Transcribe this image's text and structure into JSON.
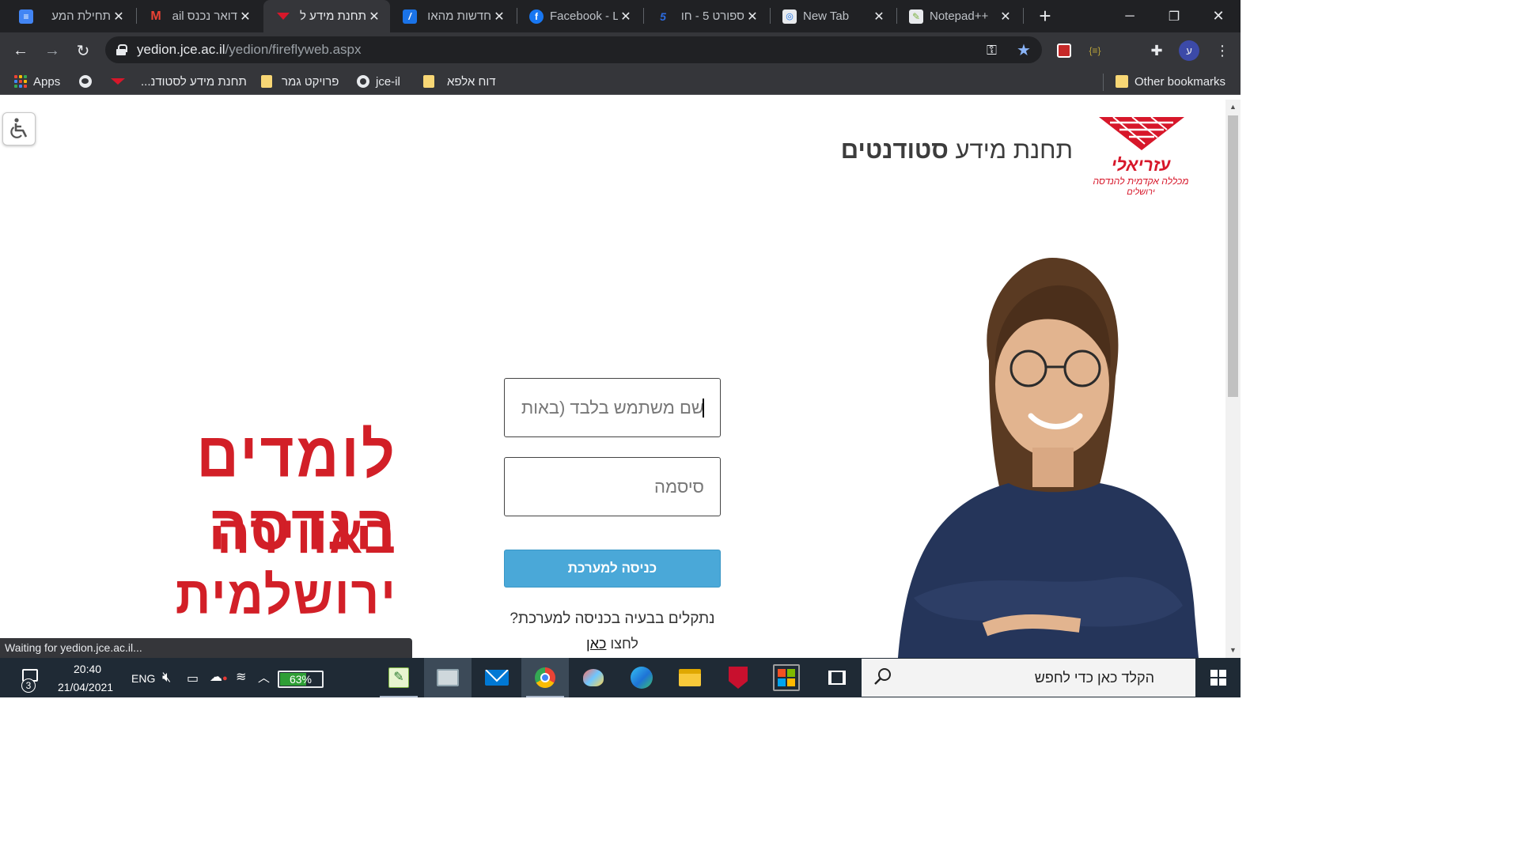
{
  "tabs": [
    {
      "title": "תחילת המע",
      "icon": "google-docs-icon",
      "color": "#4285f4"
    },
    {
      "title": "דואר נכנס ail",
      "icon": "gmail-icon",
      "color": "#ea4335"
    },
    {
      "title": "תחנת מידע ל",
      "icon": "azrieli-icon",
      "color": "#d7172a"
    },
    {
      "title": "חדשות מהאו",
      "icon": "news-icon",
      "color": "#1a73e8"
    },
    {
      "title": "Facebook - L",
      "icon": "facebook-icon",
      "color": "#1877f2"
    },
    {
      "title": "ספורט 5 - חו",
      "icon": "sport5-icon",
      "color": "#2c6be0"
    },
    {
      "title": "New Tab",
      "icon": "new-tab-icon",
      "color": "#9aa0a6"
    },
    {
      "title": "Notepad++ ",
      "icon": "notepadpp-icon",
      "color": "#7cb342"
    }
  ],
  "address_bar": {
    "host": "yedion.jce.ac.il",
    "path": "/yedion/fireflyweb.aspx"
  },
  "profile_initial": "ע",
  "bookmarks": {
    "apps": "Apps",
    "items": [
      "תחנת מידע לסטודנ...",
      "פרויקט גמר",
      "jce-il",
      "דוח אלפא"
    ],
    "other": "Other bookmarks"
  },
  "page": {
    "logo_name": "עזריאלי",
    "logo_sub": "מכללה אקדמית להנדסה",
    "logo_city": "ירושלים",
    "title_regular": "תחנת מידע ",
    "title_bold": "סטודנטים",
    "slogan_line1": "לומדים הנדסה",
    "slogan_line2": "באווירה ירושלמית",
    "username_placeholder": "שם משתמש בלבד (באותיות",
    "password_placeholder": "סיסמה",
    "login_button": "כניסה למערכת",
    "trouble_text": "נתקלים בבעיה בכניסה למערכת?",
    "click_prefix": "לחצו ",
    "click_link": "כאן"
  },
  "status_text": "Waiting for yedion.jce.ac.il...",
  "taskbar": {
    "notification_count": "3",
    "time": "20:40",
    "date": "21/04/2021",
    "language": "ENG",
    "battery": "63%",
    "battery_level": 0.63,
    "search_placeholder": "הקלד כאן כדי לחפש"
  }
}
